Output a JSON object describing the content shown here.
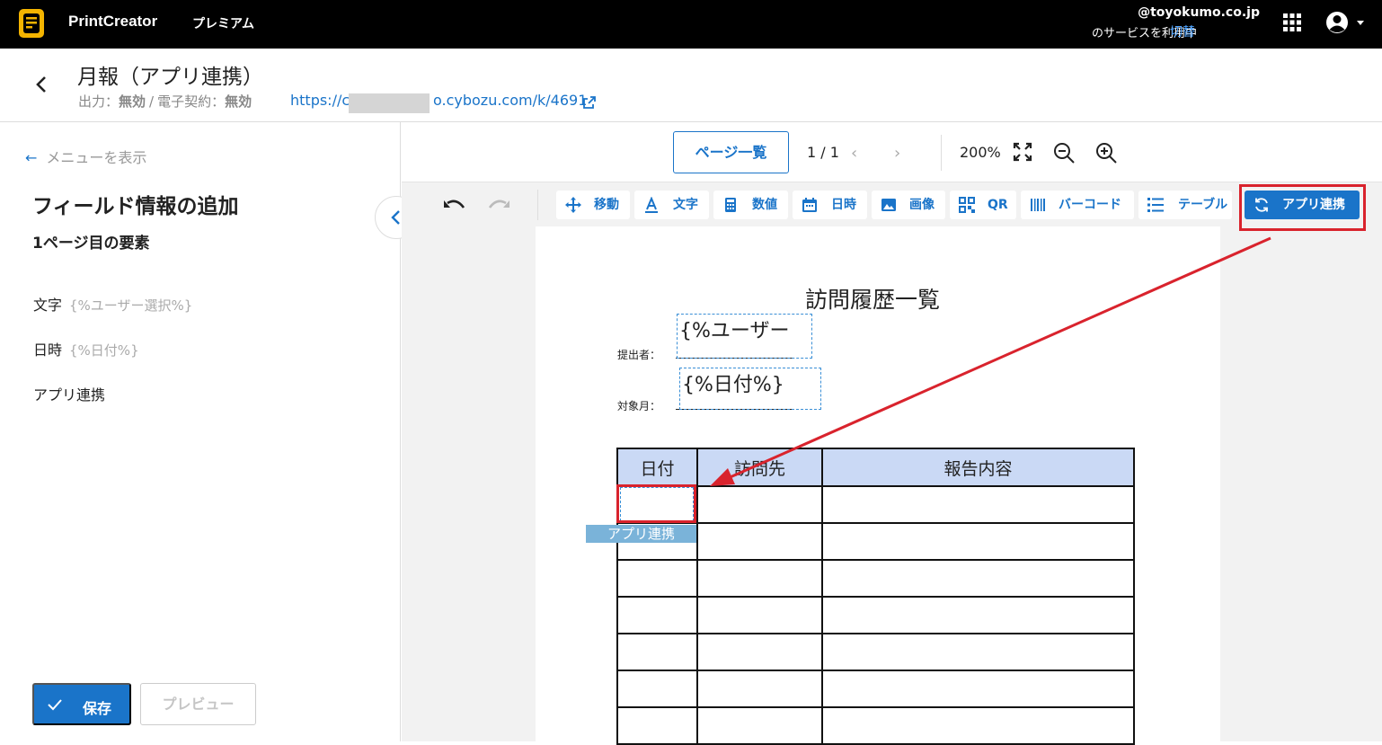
{
  "topbar": {
    "brand": "PrintCreator",
    "plan": "プレミアム",
    "account_domain": "@toyokumo.co.jp",
    "account_service": "のサービスを利用中",
    "switch_label": "切替"
  },
  "header": {
    "title": "月報（アプリ連携）",
    "output_label": "出力：",
    "output_value": "無効",
    "contract_label": "電子契約：",
    "contract_value": "無効",
    "url_prefix": "https://c",
    "url_suffix": "o.cybozu.com/k/4691"
  },
  "sidebar": {
    "menu_link": "メニューを表示",
    "title": "フィールド情報の追加",
    "subtitle": "1ページ目の要素",
    "fields": [
      {
        "label": "文字",
        "value": "{%ユーザー選択%}"
      },
      {
        "label": "日時",
        "value": "{%日付%}"
      },
      {
        "label": "アプリ連携",
        "value": ""
      }
    ],
    "save_label": "保存",
    "preview_label": "プレビュー"
  },
  "viewer": {
    "pages_button": "ページ一覧",
    "page_indicator": "1 / 1",
    "zoom": "200%"
  },
  "toolbar": {
    "tools": [
      {
        "icon": "move-icon",
        "label": "移動"
      },
      {
        "icon": "text-icon",
        "label": "文字"
      },
      {
        "icon": "calculator-icon",
        "label": "数値"
      },
      {
        "icon": "calendar-icon",
        "label": "日時"
      },
      {
        "icon": "image-icon",
        "label": "画像"
      },
      {
        "icon": "qr-icon",
        "label": "QR"
      },
      {
        "icon": "barcode-icon",
        "label": "バーコード"
      },
      {
        "icon": "table-icon",
        "label": "テーブル"
      },
      {
        "icon": "sync-icon",
        "label": "アプリ連携"
      }
    ],
    "highlight_color": "#d9232d"
  },
  "document": {
    "title": "訪問履歴一覧",
    "submitter_label": "提出者：",
    "submitter_field": "{%ユーザー",
    "month_label": "対象月：",
    "month_field": "{%日付%}",
    "table_headers": [
      "日付",
      "訪問先",
      "報告内容"
    ],
    "placed_element_label": "アプリ連携"
  },
  "colors": {
    "accent": "#1a74c9",
    "annotation": "#d9232d",
    "table_header_bg": "#cad9f5"
  }
}
